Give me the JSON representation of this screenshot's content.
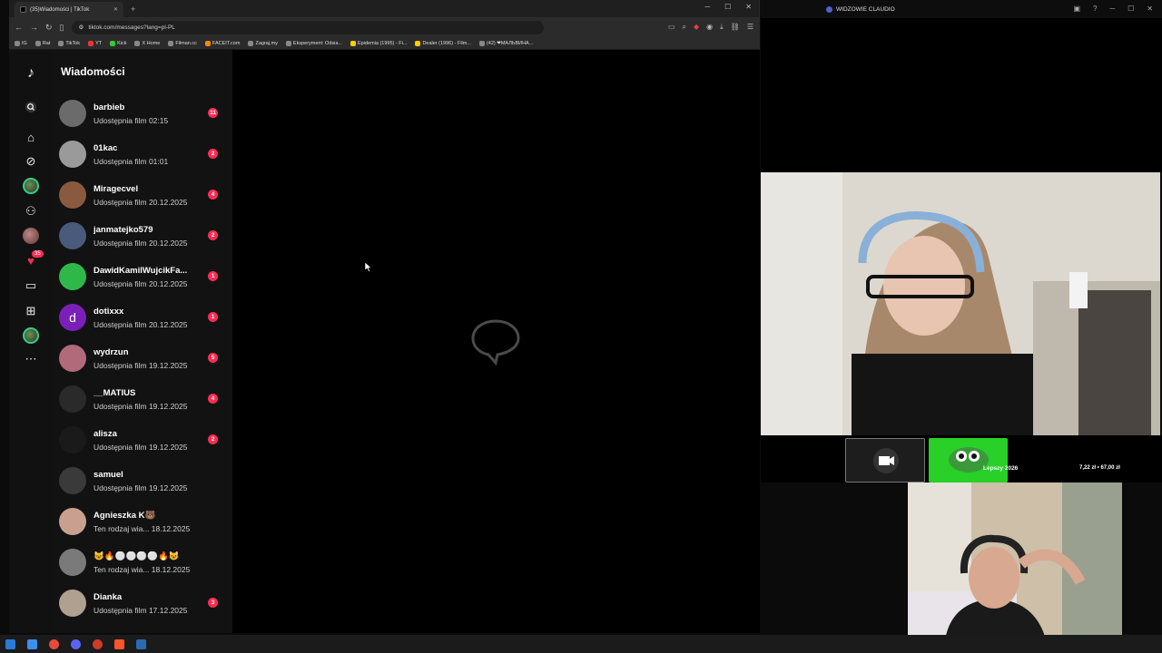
{
  "browser": {
    "tab_title": "(35)Wiadomości | TikTok",
    "url": "tiktok.com/messages?lang=pl-PL",
    "bookmarks": [
      "IG",
      "Rat",
      "TikTok",
      "YT",
      "Kick",
      "X Home",
      "Filman.cc",
      "FACEIT.com",
      "Zagraj.my",
      "Eksperyment: Odsia...",
      "Epidemia (1995) - Fi...",
      "Dealer (1996) - Film...",
      "(42) ❤МАЛЬВИНА..."
    ]
  },
  "tiktok": {
    "header": "Wiadomości",
    "nav_badge": "35",
    "conversations": [
      {
        "name": "barbieb",
        "sub": "Udostępnia film 02:15",
        "badge": "11",
        "color": "#6b6b6b"
      },
      {
        "name": "01kac",
        "sub": "Udostępnia film 01:01",
        "badge": "2",
        "color": "#9a9a9a"
      },
      {
        "name": "Miragecvel",
        "sub": "Udostępnia film 20.12.2025",
        "badge": "4",
        "color": "#8a5a40"
      },
      {
        "name": "janmatejko579",
        "sub": "Udostępnia film 20.12.2025",
        "badge": "2",
        "color": "#4a5a7a"
      },
      {
        "name": "DawidKamilWujcikFa...",
        "sub": "Udostępnia film 20.12.2025",
        "badge": "1",
        "color": "#2fb84a"
      },
      {
        "name": "dotixxx",
        "sub": "Udostępnia film 20.12.2025",
        "badge": "1",
        "color": "#7a1fb8",
        "initial": "d"
      },
      {
        "name": "wydrzun",
        "sub": "Udostępnia film 19.12.2025",
        "badge": "5",
        "color": "#b06a7a"
      },
      {
        "name": "__MATIUS",
        "sub": "Udostępnia film 19.12.2025",
        "badge": "4",
        "color": "#2a2a2a"
      },
      {
        "name": "alisza",
        "sub": "Udostępnia film 19.12.2025",
        "badge": "2",
        "color": "#1a1a1a"
      },
      {
        "name": "samuel",
        "sub": "Udostępnia film 19.12.2025",
        "badge": "",
        "color": "#3a3a3a"
      },
      {
        "name": "Agnieszka K🐻",
        "sub": "Ten rodzaj wia...  18.12.2025",
        "badge": "",
        "color": "#c9a090"
      },
      {
        "name": "😺🔥⚪⚪⚪⚪🔥😺",
        "sub": "Ten rodzaj wia...  18.12.2025",
        "badge": "",
        "color": "#7a7a7a"
      },
      {
        "name": "Dianka",
        "sub": "Udostępnia film 17.12.2025",
        "badge": "3",
        "color": "#b0a090"
      }
    ]
  },
  "stream": {
    "title": "WIDZOWIE CLAUDIO",
    "overlay_label": "Lepszy 2026",
    "overlay_money": "7,22 zł • 67,00 zł"
  },
  "colors": {
    "accent": "#fe2c55",
    "green": "#28d028"
  }
}
